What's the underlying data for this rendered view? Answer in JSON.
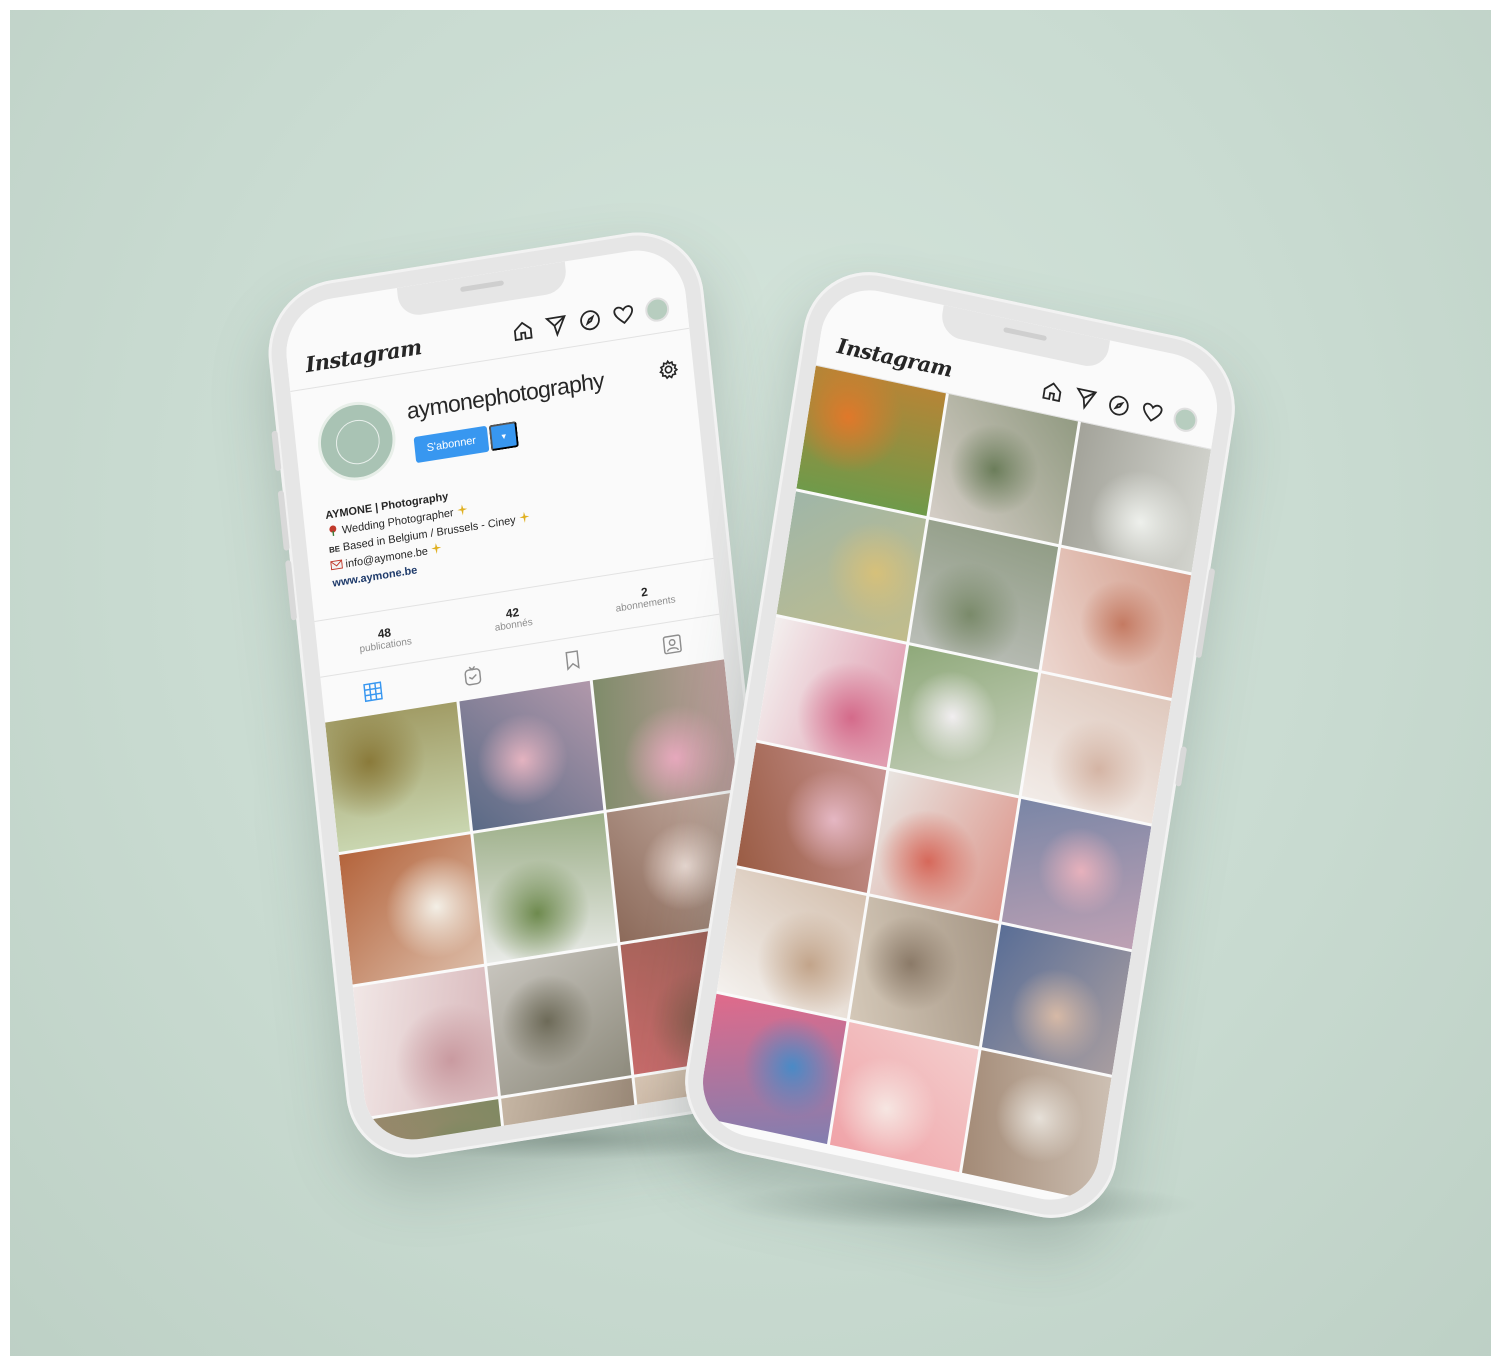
{
  "background_color": "#c9dbd1",
  "phone_left": {
    "app_logo": "Instagram",
    "header_icons": [
      "home-icon",
      "direct-icon",
      "explore-icon",
      "heart-icon",
      "avatar"
    ],
    "profile": {
      "username": "aymonephotography",
      "follow_button": "S'abonner",
      "more_button": "▾",
      "bio_name": "AYMONE | Photography",
      "bio_line1": "Wedding Photographer",
      "bio_line2_prefix": "BE",
      "bio_line2": "Based in Belgium / Brussels - Ciney",
      "bio_line3": "info@aymone.be",
      "website": "www.aymone.be"
    },
    "stats": [
      {
        "num": "48",
        "label": "publications"
      },
      {
        "num": "42",
        "label": "abonnés"
      },
      {
        "num": "2",
        "label": "abonnements"
      }
    ],
    "tabs": [
      "grid-icon",
      "igtv-icon",
      "saved-icon",
      "tagged-icon"
    ],
    "accent_color": "#3897f0",
    "photos": [
      {
        "name": "photo-rings",
        "c1": "#c9d6b0",
        "c2": "#8a7a3a"
      },
      {
        "name": "photo-grooms-kiss",
        "c1": "#5a6a86",
        "c2": "#e4b3c0"
      },
      {
        "name": "photo-groom-pink-suit",
        "c1": "#7f8c6a",
        "c2": "#e7a9bd"
      },
      {
        "name": "photo-bouquet-white",
        "c1": "#b4643c",
        "c2": "#f3efe6"
      },
      {
        "name": "photo-couple-field",
        "c1": "#e9ebe8",
        "c2": "#6e8a4e"
      },
      {
        "name": "photo-couple-forehead",
        "c1": "#8c6a5a",
        "c2": "#e9d9d2"
      },
      {
        "name": "photo-lace-hands",
        "c1": "#f1e7e6",
        "c2": "#c99aa0"
      },
      {
        "name": "photo-chapel",
        "c1": "#c7c4bd",
        "c2": "#6d6a58"
      },
      {
        "name": "photo-red-door",
        "c1": "#c86b6b",
        "c2": "#8a5b4b"
      },
      {
        "name": "photo-group-a",
        "c1": "#a48870",
        "c2": "#6b8a5a"
      },
      {
        "name": "photo-group-b",
        "c1": "#c6b6a4",
        "c2": "#6c5a4a"
      },
      {
        "name": "photo-group-c",
        "c1": "#d8c6b4",
        "c2": "#8a6a5a"
      }
    ]
  },
  "phone_right": {
    "app_logo": "Instagram",
    "header_icons": [
      "home-icon",
      "direct-icon",
      "explore-icon",
      "heart-icon",
      "avatar"
    ],
    "photos": [
      {
        "name": "photo-flowers-table",
        "c1": "#6f9a4a",
        "c2": "#e0782a"
      },
      {
        "name": "photo-church-couple",
        "c1": "#d4cdc6",
        "c2": "#6b7d5a"
      },
      {
        "name": "photo-window-couple",
        "c1": "#a3a39a",
        "c2": "#eef0ec"
      },
      {
        "name": "photo-succulent-rings",
        "c1": "#9fb6a8",
        "c2": "#d6c07a"
      },
      {
        "name": "photo-gate-couple",
        "c1": "#b9bdb6",
        "c2": "#7a8a6a"
      },
      {
        "name": "photo-hair-detail",
        "c1": "#ecd6cf",
        "c2": "#c47a62"
      },
      {
        "name": "photo-bride-bouquet",
        "c1": "#f3efee",
        "c2": "#d46a8a"
      },
      {
        "name": "photo-garden-kiss",
        "c1": "#8fa97a",
        "c2": "#f1eef0"
      },
      {
        "name": "photo-bride-hands",
        "c1": "#f2ece8",
        "c2": "#d4b4a4"
      },
      {
        "name": "photo-brick-wall",
        "c1": "#9a5c44",
        "c2": "#e5b7c3"
      },
      {
        "name": "photo-table-setting",
        "c1": "#e8e4e0",
        "c2": "#d6685a"
      },
      {
        "name": "photo-shoes-pink",
        "c1": "#7a86a6",
        "c2": "#e7b1bc"
      },
      {
        "name": "photo-bride-dress",
        "c1": "#f4f1ee",
        "c2": "#c2a48a"
      },
      {
        "name": "photo-arcade",
        "c1": "#d4c8b8",
        "c2": "#8b7a68"
      },
      {
        "name": "photo-blue-closeup",
        "c1": "#5a6e96",
        "c2": "#d6b9a6"
      },
      {
        "name": "photo-bounce-castle",
        "c1": "#e06a8a",
        "c2": "#4a8ac6"
      },
      {
        "name": "photo-peonies",
        "c1": "#f0a3a8",
        "c2": "#f6e6e2"
      },
      {
        "name": "photo-bubbles",
        "c1": "#a38a76",
        "c2": "#e6e0d8"
      }
    ]
  }
}
